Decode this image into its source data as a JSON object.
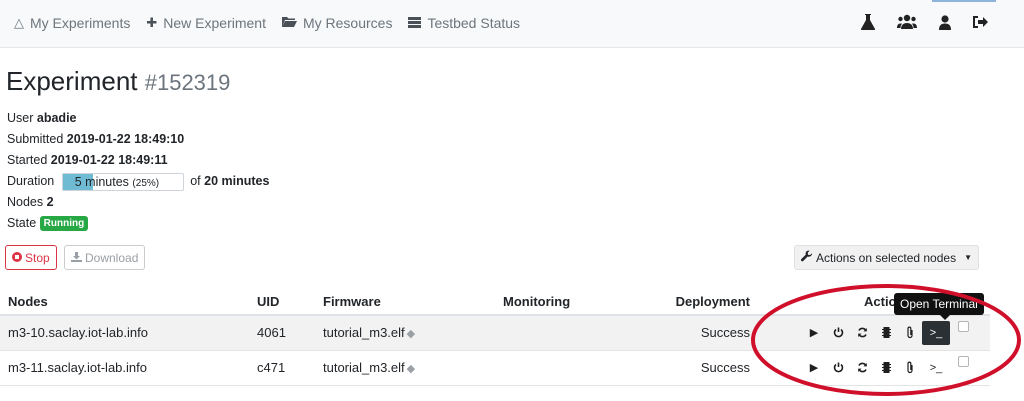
{
  "nav": {
    "items": [
      {
        "label": "My Experiments",
        "icon": "flask-icon"
      },
      {
        "label": "New Experiment",
        "icon": "plus-icon"
      },
      {
        "label": "My Resources",
        "icon": "folder-icon"
      },
      {
        "label": "Testbed Status",
        "icon": "server-icon"
      }
    ],
    "right_icons": [
      "flask-icon",
      "users-icon",
      "user-icon",
      "sign-out-icon"
    ]
  },
  "experiment": {
    "title": "Experiment",
    "id": "#152319",
    "user_label": "User",
    "user": "abadie",
    "submitted_label": "Submitted",
    "submitted": "2019-01-22 18:49:10",
    "started_label": "Started",
    "started": "2019-01-22 18:49:11",
    "duration_label": "Duration",
    "duration_value": "5 minutes",
    "duration_percent": "(25%)",
    "duration_progress": 0.25,
    "duration_of": "of",
    "duration_total": "20 minutes",
    "nodes_label": "Nodes",
    "nodes": "2",
    "state_label": "State",
    "state": "Running"
  },
  "buttons": {
    "stop": "Stop",
    "download": "Download",
    "actions": "Actions on selected nodes"
  },
  "table": {
    "headers": {
      "nodes": "Nodes",
      "uid": "UID",
      "firmware": "Firmware",
      "monitoring": "Monitoring",
      "deployment": "Deployment",
      "actions": "Actions"
    },
    "rows": [
      {
        "node": "m3-10.saclay.iot-lab.info",
        "uid": "4061",
        "firmware": "tutorial_m3.elf",
        "monitoring": "",
        "deployment": "Success"
      },
      {
        "node": "m3-11.saclay.iot-lab.info",
        "uid": "c471",
        "firmware": "tutorial_m3.elf",
        "monitoring": "",
        "deployment": "Success"
      }
    ]
  },
  "tooltip": "Open Terminal",
  "colors": {
    "highlight_ring": "#d0102a",
    "running_badge": "#28a745",
    "stop": "#dc3545",
    "progress": "#6fbbd3"
  }
}
